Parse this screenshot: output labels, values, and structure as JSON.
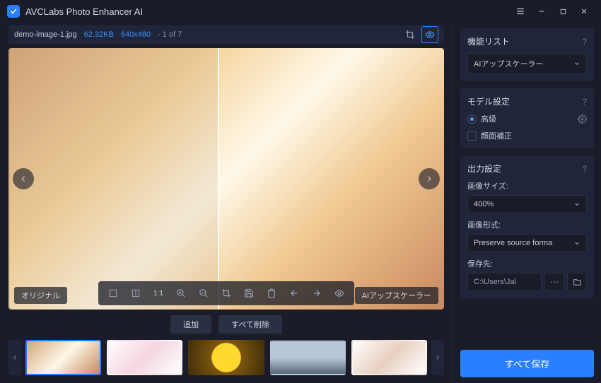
{
  "app": {
    "title": "AVCLabs Photo Enhancer AI"
  },
  "info": {
    "filename": "demo-image-1.jpg",
    "filesize": "62.32KB",
    "dimensions": "640x480",
    "counter": "- 1 of 7"
  },
  "preview": {
    "original_label": "オリジナル",
    "mode_label": "AIアップスケーラー"
  },
  "actions": {
    "add": "追加",
    "delete_all": "すべて削除"
  },
  "panels": {
    "features": {
      "title": "機能リスト",
      "selected": "AIアップスケーラー"
    },
    "model": {
      "title": "モデル設定",
      "advanced": "高級",
      "face_refine": "顔面補正"
    },
    "output": {
      "title": "出力設定",
      "size_label": "画像サイズ:",
      "size_value": "400%",
      "format_label": "画像形式:",
      "format_value": "Preserve source forma",
      "path_label": "保存先:",
      "path_value": "C:\\Users\\Jal"
    }
  },
  "save_all": "すべて保存"
}
